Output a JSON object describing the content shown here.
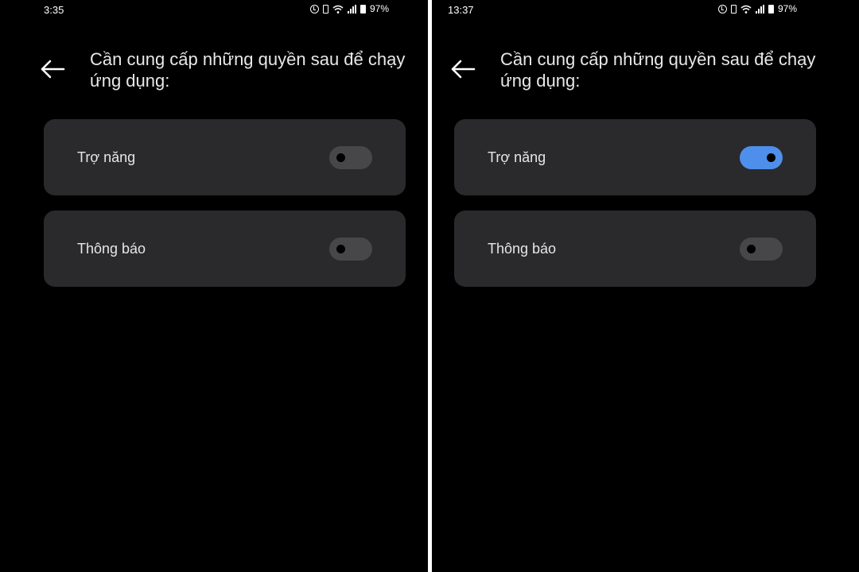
{
  "screens": [
    {
      "status_bar": {
        "time": "3:35",
        "battery": "97%"
      },
      "header": {
        "title": "Cần cung cấp những quyền sau để chạy ứng dụng:"
      },
      "permissions": [
        {
          "label": "Trợ năng",
          "enabled": false
        },
        {
          "label": "Thông báo",
          "enabled": false
        }
      ]
    },
    {
      "status_bar": {
        "time": "13:37",
        "battery": "97%"
      },
      "header": {
        "title": "Cần cung cấp những quyền sau để chạy ứng dụng:"
      },
      "permissions": [
        {
          "label": "Trợ năng",
          "enabled": true
        },
        {
          "label": "Thông báo",
          "enabled": false
        }
      ]
    }
  ],
  "colors": {
    "background": "#000000",
    "card": "#2a2a2c",
    "toggle_on": "#4f8fec",
    "toggle_off": "#47474a"
  },
  "icons": [
    "back-arrow-icon",
    "alarm-clock-icon",
    "vibrate-icon",
    "wifi-icon",
    "cellular-signal-icon",
    "battery-icon"
  ]
}
